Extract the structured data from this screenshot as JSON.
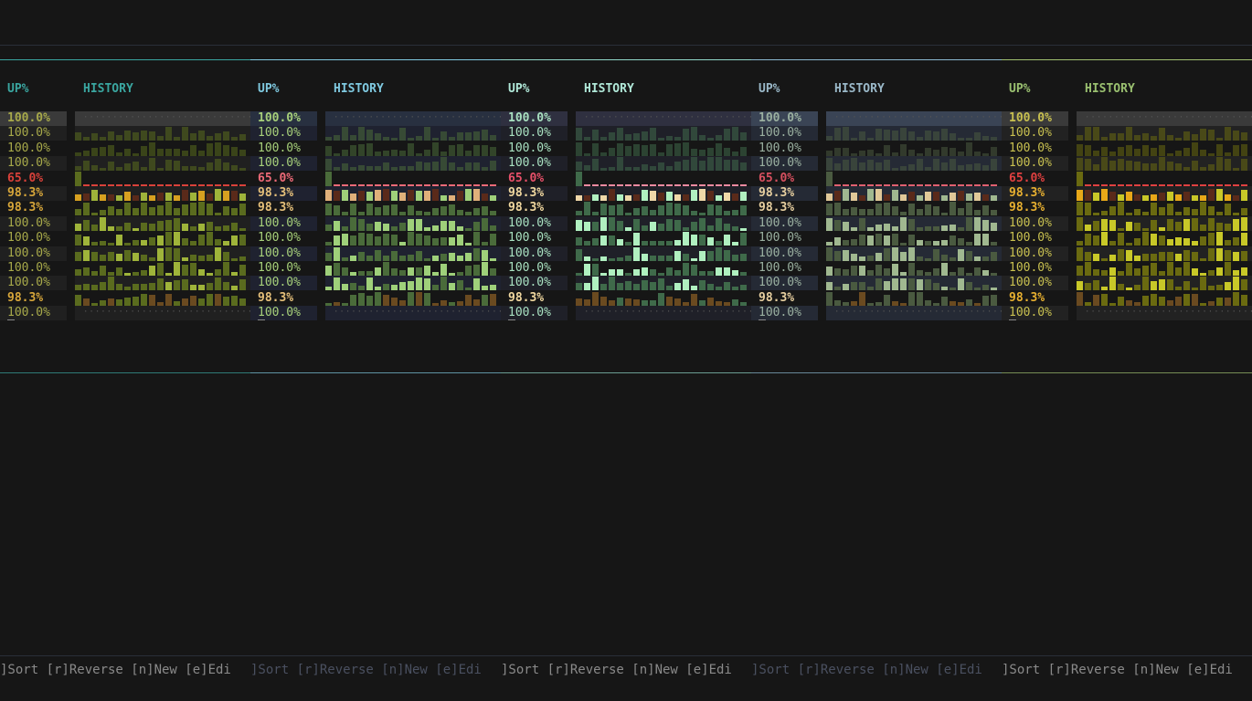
{
  "columns": {
    "up_header": "UP%",
    "history_header": "HISTORY"
  },
  "rows": [
    {
      "up": "100.0%",
      "status": "ok-selected"
    },
    {
      "up": "100.0%",
      "status": "ok"
    },
    {
      "up": "100.0%",
      "status": "ok"
    },
    {
      "up": "100.0%",
      "status": "ok"
    },
    {
      "up": "65.0%",
      "status": "bad"
    },
    {
      "up": "98.3%",
      "status": "warn"
    },
    {
      "up": "98.3%",
      "status": "warn"
    },
    {
      "up": "100.0%",
      "status": "ok"
    },
    {
      "up": "100.0%",
      "status": "ok"
    },
    {
      "up": "100.0%",
      "status": "ok"
    },
    {
      "up": "100.0%",
      "status": "ok"
    },
    {
      "up": "100.0%",
      "status": "ok"
    },
    {
      "up": "98.3%",
      "status": "warn"
    },
    {
      "up": "100.0%",
      "status": "ok"
    }
  ],
  "footer": {
    "hint": "]Sort [r]Reverse [n]New [e]Edi"
  },
  "themes": [
    {
      "name": "band-1",
      "accent": "#3aa6a0",
      "header": "#3aa6a0",
      "ok": "#a7a94a",
      "bad": "#d9413a",
      "warn": "#d7a63a",
      "selbg": "#3a3a3a",
      "altbg": "#202020",
      "bar": "#5a6b1e",
      "barHi": "#9fb43a",
      "barWarn": "#d7a020",
      "line": "#d9413a"
    },
    {
      "name": "band-2",
      "accent": "#7fc9e0",
      "header": "#7fc9e0",
      "ok": "#a7d07a",
      "bad": "#ee6a78",
      "warn": "#e6c07a",
      "selbg": "#283040",
      "altbg": "#1f2230",
      "bar": "#4a6b3a",
      "barHi": "#9fd07a",
      "barWarn": "#e0b07a",
      "line": "#ee6a78"
    },
    {
      "name": "band-3",
      "accent": "#8fd7c8",
      "header": "#b0e8d8",
      "ok": "#a8e0c0",
      "bad": "#e8506a",
      "warn": "#f2d9a0",
      "selbg": "#2f3040",
      "altbg": "#1f2028",
      "bar": "#3f6a4a",
      "barHi": "#b0f0c0",
      "barWarn": "#f0d8a8",
      "line": "#f08aa0"
    },
    {
      "name": "band-4",
      "accent": "#8ab8d0",
      "header": "#9ab8c8",
      "ok": "#9ab0a0",
      "bad": "#d85060",
      "warn": "#e8d0a0",
      "selbg": "#3a4455",
      "altbg": "#252a35",
      "bar": "#4a5a40",
      "barHi": "#a0b890",
      "barWarn": "#e0c898",
      "line": "#e06070"
    },
    {
      "name": "band-5",
      "accent": "#a0c070",
      "header": "#9ac070",
      "ok": "#c8c050",
      "bad": "#e04040",
      "warn": "#e8b030",
      "selbg": "#3a3a3a",
      "altbg": "#222222",
      "bar": "#6a6a10",
      "barHi": "#c8c828",
      "barWarn": "#e8a818",
      "line": "#e04040"
    }
  ]
}
